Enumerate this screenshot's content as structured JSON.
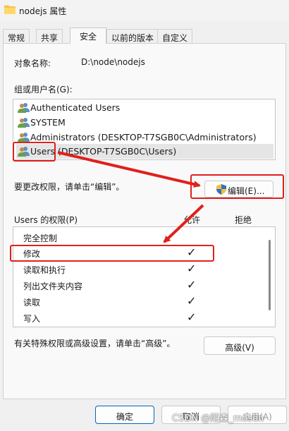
{
  "window": {
    "title": "nodejs 属性"
  },
  "tabs": [
    {
      "label": "常规"
    },
    {
      "label": "共享"
    },
    {
      "label": "安全"
    },
    {
      "label": "以前的版本"
    },
    {
      "label": "自定义"
    }
  ],
  "security": {
    "object_name_label": "对象名称:",
    "object_name_value": "D:\\node\\nodejs",
    "groups_label": "组或用户名(G):",
    "users": [
      {
        "label": "Authenticated Users"
      },
      {
        "label": "SYSTEM"
      },
      {
        "label": "Administrators (DESKTOP-T7SGB0C\\Administrators)"
      },
      {
        "label": "Users (DESKTOP-T7SGB0C\\Users)"
      }
    ],
    "change_hint": "要更改权限，请单击“编辑”。",
    "edit_button": "编辑(E)...",
    "permissions_label": "Users 的权限(P)",
    "allow_header": "允许",
    "deny_header": "拒绝",
    "permissions": [
      {
        "name": "完全控制",
        "allow": ""
      },
      {
        "name": "修改",
        "allow": "✓"
      },
      {
        "name": "读取和执行",
        "allow": "✓"
      },
      {
        "name": "列出文件夹内容",
        "allow": "✓"
      },
      {
        "name": "读取",
        "allow": "✓"
      },
      {
        "name": "写入",
        "allow": "✓"
      }
    ],
    "advanced_hint": "有关特殊权限或高级设置，请单击“高级”。",
    "advanced_button": "高级(V)"
  },
  "footer": {
    "ok_button": "确定",
    "cancel_button": "取消",
    "apply_button": "应用(A)"
  },
  "watermark": "CSDN @陌森_mosen",
  "colors": {
    "annotation_red": "#e0201c",
    "selection": "#e5e5e5",
    "accent": "#0067c0"
  }
}
